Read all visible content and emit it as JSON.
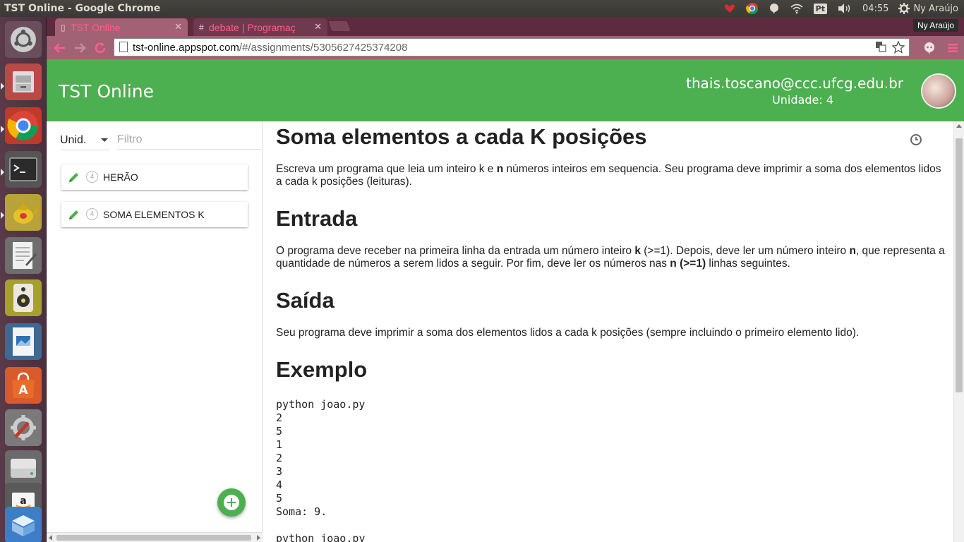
{
  "top_panel": {
    "window_title": "TST Online - Google Chrome",
    "keyboard_layout": "Pt",
    "clock": "04:55",
    "user": "Ny Araújo"
  },
  "browser": {
    "tabs": [
      {
        "label": "TST Online",
        "active": true
      },
      {
        "label": "debate | Programaç",
        "active": false
      }
    ],
    "profile_name": "Ny Araújo",
    "url_host": "tst-online.appspot.com",
    "url_path": "/#/assignments/5305627425374208"
  },
  "app": {
    "title": "TST Online",
    "user_email": "thais.toscano@ccc.ufcg.edu.br",
    "user_unit": "Unidade: 4",
    "brand_color": "#4caf50"
  },
  "sidebar": {
    "unit_select": "Unid.",
    "filter_placeholder": "Filtro",
    "items": [
      {
        "unit": "4",
        "label": "HERÃO"
      },
      {
        "unit": "4",
        "label": "SOMA ELEMENTOS K"
      }
    ]
  },
  "content": {
    "title": "Soma elementos a cada K posições",
    "intro_1": "Escreva um programa que leia um inteiro k e ",
    "intro_b1": "n",
    "intro_2": " números inteiros em sequencia. Seu programa deve imprimir a soma dos elementos lidos a cada k posições (leituras).",
    "entrada_title": "Entrada",
    "entrada_1": "O programa deve receber na primeira linha da entrada um número inteiro ",
    "entrada_b1": "k",
    "entrada_2": " (>=1). Depois, deve ler um número inteiro ",
    "entrada_b2": "n",
    "entrada_3": ", que representa a quantidade de números a serem lidos a seguir. Por fim, deve ler os números nas ",
    "entrada_b3": "n (>=1)",
    "entrada_4": " linhas seguintes.",
    "saida_title": "Saída",
    "saida_text": "Seu programa deve imprimir a soma dos elementos lidos a cada k posições (sempre incluindo o primeiro elemento lido).",
    "exemplo_title": "Exemplo",
    "example_code": "python joao.py\n2\n5\n1\n2\n3\n4\n5\nSoma: 9.\n\npython joao.py"
  }
}
